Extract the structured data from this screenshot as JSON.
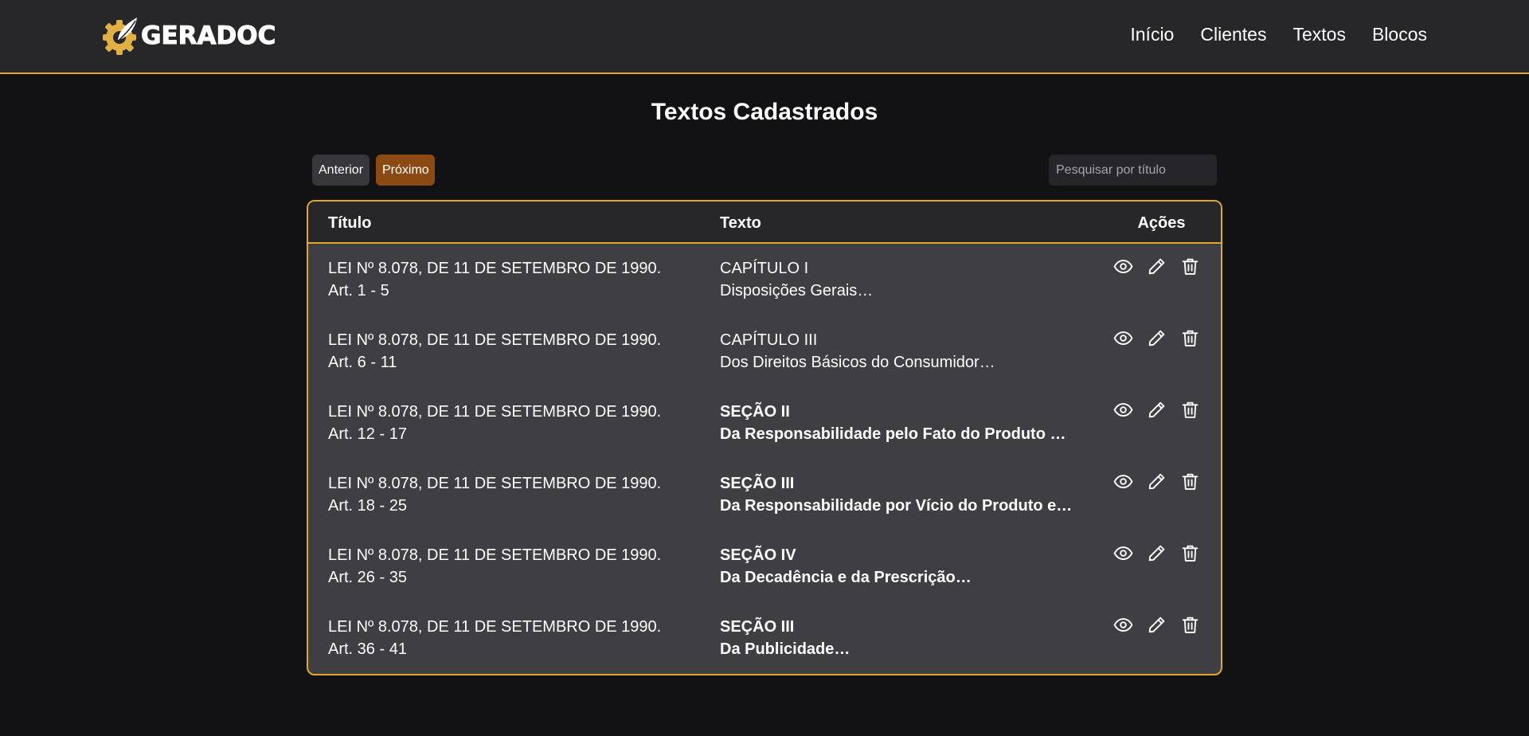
{
  "app": {
    "logo_text": "GERADOC",
    "brand_color": "#e0a82e"
  },
  "nav": {
    "items": [
      {
        "label": "Início"
      },
      {
        "label": "Clientes"
      },
      {
        "label": "Textos"
      },
      {
        "label": "Blocos"
      }
    ]
  },
  "page": {
    "title": "Textos Cadastrados"
  },
  "pager": {
    "prev_label": "Anterior",
    "next_label": "Próximo"
  },
  "search": {
    "placeholder": "Pesquisar por título",
    "value": ""
  },
  "table": {
    "headers": {
      "titulo": "Título",
      "texto": "Texto",
      "acoes": "Ações"
    },
    "action_icons": [
      "eye-icon",
      "pencil-icon",
      "trash-icon"
    ],
    "rows": [
      {
        "titulo": "LEI Nº 8.078, DE 11 DE SETEMBRO DE 1990.",
        "artigos": "Art. 1 - 5",
        "texto_1": "CAPÍTULO I",
        "texto_2": "Disposições Gerais…",
        "bold": false
      },
      {
        "titulo": "LEI Nº 8.078, DE 11 DE SETEMBRO DE 1990.",
        "artigos": "Art. 6 - 11",
        "texto_1": "CAPÍTULO III",
        "texto_2": "Dos Direitos Básicos do Consumidor…",
        "bold": false
      },
      {
        "titulo": "LEI Nº 8.078, DE 11 DE SETEMBRO DE 1990.",
        "artigos": "Art. 12 - 17",
        "texto_1": "SEÇÃO II",
        "texto_2": "Da Responsabilidade pelo Fato do Produto …",
        "bold": true
      },
      {
        "titulo": "LEI Nº 8.078, DE 11 DE SETEMBRO DE 1990.",
        "artigos": "Art. 18 - 25",
        "texto_1": "SEÇÃO III",
        "texto_2": "Da Responsabilidade por Vício do Produto e…",
        "bold": true
      },
      {
        "titulo": "LEI Nº 8.078, DE 11 DE SETEMBRO DE 1990.",
        "artigos": "Art. 26 - 35",
        "texto_1": "SEÇÃO IV",
        "texto_2": "Da Decadência e da Prescrição…",
        "bold": true
      },
      {
        "titulo": "LEI Nº 8.078, DE 11 DE SETEMBRO DE 1990.",
        "artigos": "Art. 36 - 41",
        "texto_1": "SEÇÃO III",
        "texto_2": "Da Publicidade…",
        "bold": true
      }
    ]
  }
}
